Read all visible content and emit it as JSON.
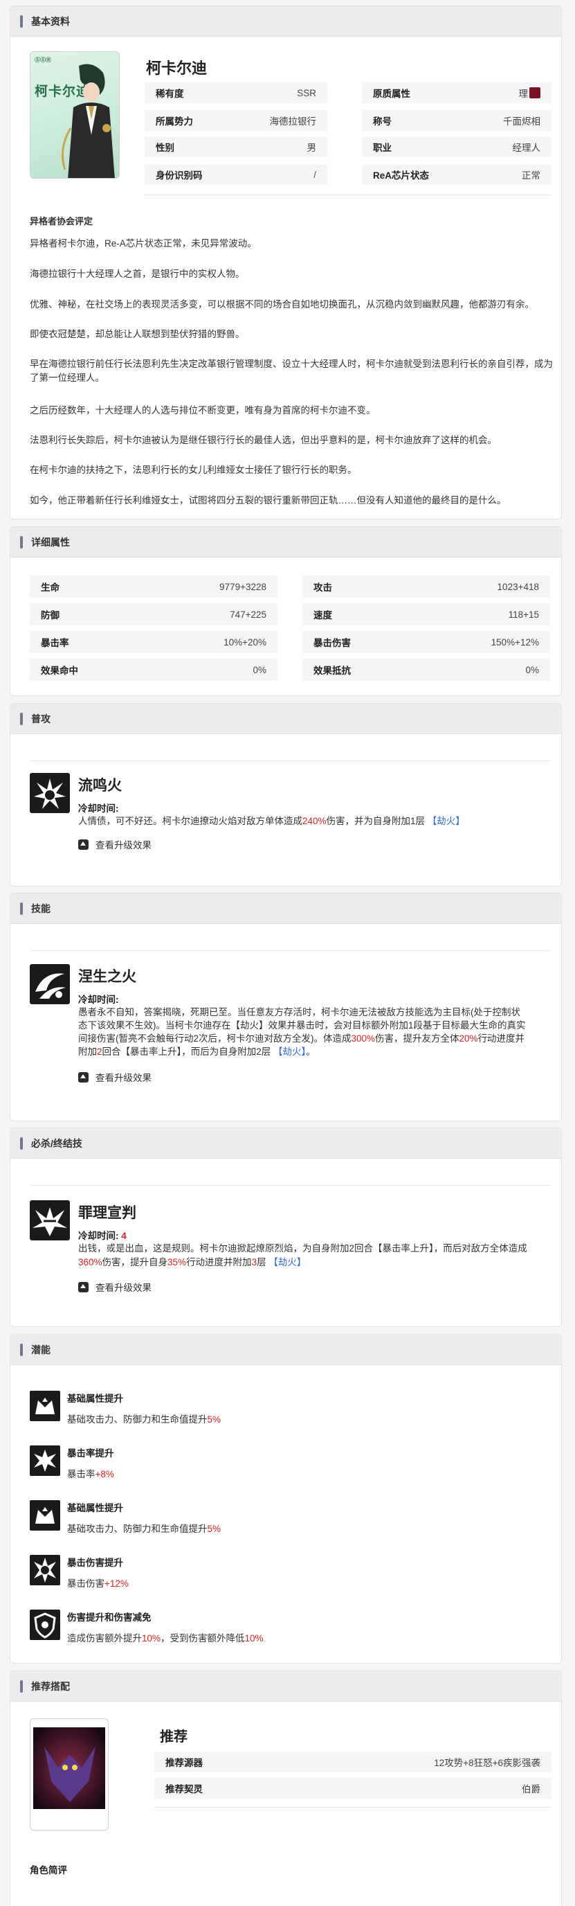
{
  "basic": {
    "section_title": "基本资料",
    "name": "柯卡尔迪",
    "card_logo": "ⓈⓈⓇ",
    "card_title": "柯卡尔迪",
    "attrs": [
      {
        "k": "稀有度",
        "v": "SSR"
      },
      {
        "k": "原质属性",
        "v": "理"
      },
      {
        "k": "所属势力",
        "v": "海德拉银行"
      },
      {
        "k": "称号",
        "v": "千面烬相"
      },
      {
        "k": "性别",
        "v": "男"
      },
      {
        "k": "职业",
        "v": "经理人"
      },
      {
        "k": "身份识别码",
        "v": "/"
      },
      {
        "k": "ReA芯片状态",
        "v": "正常"
      }
    ],
    "assessment_title": "异格者协会评定",
    "paragraphs": [
      "异格者柯卡尔迪，Re-A芯片状态正常，未见异常波动。",
      "海德拉银行十大经理人之首，是银行中的实权人物。",
      "优雅、神秘，在社交场上的表现灵活多变，可以根据不同的场合自如地切换面孔，从沉稳内敛到幽默风趣，他都游刃有余。",
      "即使衣冠楚楚，却总能让人联想到垫伏狩猎的野兽。",
      "早在海德拉银行前任行长法恩利先生决定改革银行管理制度、设立十大经理人时，柯卡尔迪就受到法恩利行长的亲自引荐，成为了第一位经理人。",
      "之后历经数年，十大经理人的人选与排位不断变更，唯有身为首席的柯卡尔迪不变。",
      "法恩利行长失踪后，柯卡尔迪被认为是继任银行行长的最佳人选，但出乎意料的是，柯卡尔迪放弃了这样的机会。",
      "在柯卡尔迪的扶持之下，法恩利行长的女儿利维娅女士接任了银行行长的职务。",
      "如今，他正带着新任行长利维娅女士，试图将四分五裂的银行重新带回正轨……但没有人知道他的最终目的是什么。"
    ]
  },
  "stats": {
    "section_title": "详细属性",
    "items": [
      {
        "k": "生命",
        "v": "9779+3228"
      },
      {
        "k": "攻击",
        "v": "1023+418"
      },
      {
        "k": "防御",
        "v": "747+225"
      },
      {
        "k": "速度",
        "v": "118+15"
      },
      {
        "k": "暴击率",
        "v": "10%+20%"
      },
      {
        "k": "暴击伤害",
        "v": "150%+12%"
      },
      {
        "k": "效果命中",
        "v": "0%"
      },
      {
        "k": "效果抵抗",
        "v": "0%"
      }
    ]
  },
  "normal": {
    "section_title": "普攻",
    "name": "流鸣火",
    "cd_label": "冷却时间:",
    "desc_a": "人情债，可不好还。柯卡尔迪撩动火焰对敌方单体造成",
    "desc_red": "240%",
    "desc_b": "伤害，并为自身附加1层",
    "desc_link": "【劫火】",
    "upgrade": "查看升级效果"
  },
  "skill": {
    "section_title": "技能",
    "name": "涅生之火",
    "cd_label": "冷却时间:",
    "l1": "愚者永不自知，答案揭晓，死期已至。当任意友方存活时，柯卡尔迪无法被敌方技能选为主目标(处于控制状",
    "l2": "态下该效果不生效)。当柯卡尔迪存在【劫火】效果并暴击时，会对目标额外附加1段基于目标最大生命的真实",
    "l3": "间接伤害(暂亮不会触每行动2次后，柯卡尔迪对敌方全发)。体造成",
    "l3_red1": "300%",
    "l3_b": "伤害，提升友方全体",
    "l3_red2": "20%",
    "l3_c": "行动进度并",
    "l4_a": "附加",
    "l4_red": "2",
    "l4_b": "回合【暴击率上升】，而后为自身附加2层",
    "l4_link": "【劫火】",
    "l4_end": "。",
    "upgrade": "查看升级效果"
  },
  "ultimate": {
    "section_title": "必杀/终结技",
    "name": "罪理宣判",
    "cd_label": "冷却时间:",
    "cd_value": "4",
    "l1": "出钱，或是出血，这是规则。柯卡尔迪掀起燎原烈焰，为自身附加2回合【暴击率上升】，而后对敌方全体造成",
    "l2_red1": "360%",
    "l2_a": "伤害，提升自身",
    "l2_red2": "35%",
    "l2_b": "行动进度并附加",
    "l2_red3": "3",
    "l2_c": "层",
    "l2_link": "【劫火】",
    "upgrade": "查看升级效果"
  },
  "potential": {
    "section_title": "潜能",
    "items": [
      {
        "name": "基础属性提升",
        "desc": "基础攻击力、防御力和生命值提升",
        "val": "5%",
        "icon": "crown-up-icon"
      },
      {
        "name": "暴击率提升",
        "desc": "暴击率",
        "val": "+8%",
        "icon": "burst-icon"
      },
      {
        "name": "基础属性提升",
        "desc": "基础攻击力、防御力和生命值提升",
        "val": "5%",
        "icon": "crown-up-icon"
      },
      {
        "name": "暴击伤害提升",
        "desc": "暴击伤害",
        "val": "+12%",
        "icon": "burst-ring-icon"
      },
      {
        "name": "伤害提升和伤害减免",
        "desc_a": "造成伤害额外提升",
        "val_a": "10%",
        "desc_b": "，受到伤害额外降低",
        "val_b": "10%",
        "icon": "shield-icon"
      }
    ]
  },
  "recommend": {
    "section_title": "推荐搭配",
    "title": "推荐",
    "rows": [
      {
        "k": "推荐源器",
        "v": "12攻势+8狂怒+6疾影强袭"
      },
      {
        "k": "推荐契灵",
        "v": "伯爵"
      }
    ],
    "review_title": "角色简评"
  }
}
